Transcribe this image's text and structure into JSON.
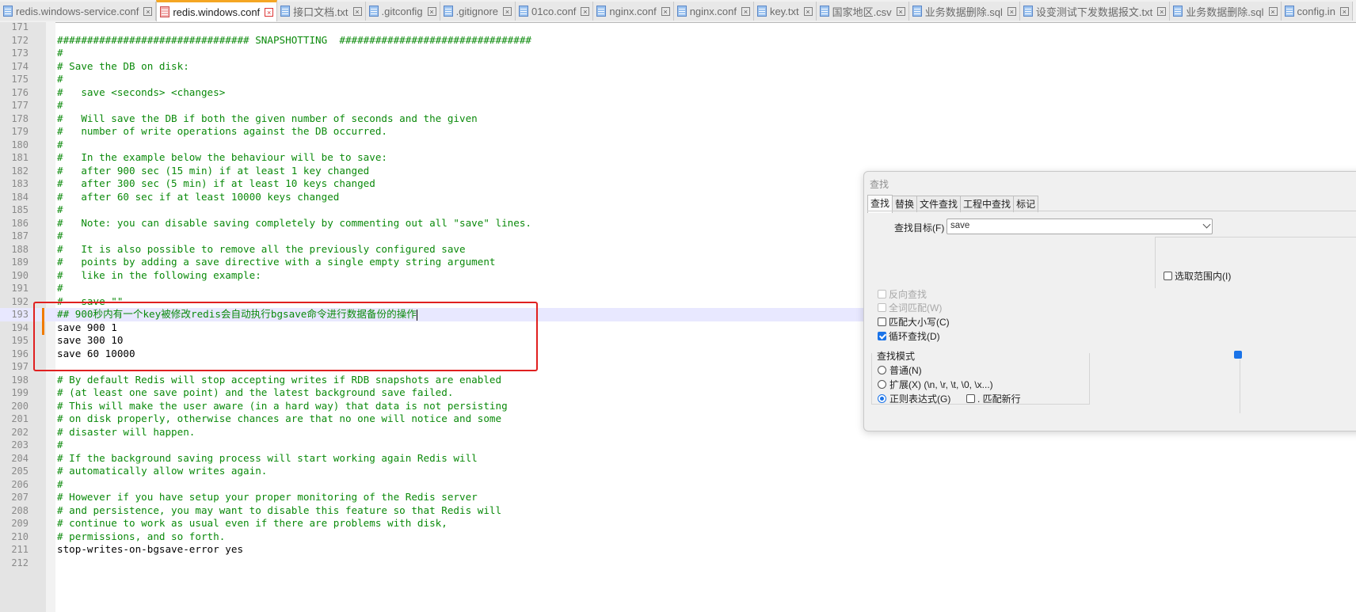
{
  "tabs": [
    {
      "label": "redis.windows-service.conf",
      "active": false
    },
    {
      "label": "redis.windows.conf",
      "active": true
    },
    {
      "label": "接口文档.txt",
      "active": false
    },
    {
      "label": ".gitconfig",
      "active": false
    },
    {
      "label": ".gitignore",
      "active": false
    },
    {
      "label": "01co.conf",
      "active": false
    },
    {
      "label": "nginx.conf",
      "active": false
    },
    {
      "label": "nginx.conf",
      "active": false
    },
    {
      "label": "key.txt",
      "active": false
    },
    {
      "label": "国家地区.csv",
      "active": false
    },
    {
      "label": "业务数据删除.sql",
      "active": false
    },
    {
      "label": "设变测试下发数据报文.txt",
      "active": false
    },
    {
      "label": "业务数据删除.sql",
      "active": false
    },
    {
      "label": "config.in",
      "active": false
    }
  ],
  "editor": {
    "current_line": "193",
    "lines": [
      {
        "n": "171",
        "text": "",
        "type": "plain"
      },
      {
        "n": "172",
        "text": "################################ SNAPSHOTTING  ################################",
        "type": "comment"
      },
      {
        "n": "173",
        "text": "#",
        "type": "comment"
      },
      {
        "n": "174",
        "text": "# Save the DB on disk:",
        "type": "comment"
      },
      {
        "n": "175",
        "text": "#",
        "type": "comment"
      },
      {
        "n": "176",
        "text": "#   save <seconds> <changes>",
        "type": "comment"
      },
      {
        "n": "177",
        "text": "#",
        "type": "comment"
      },
      {
        "n": "178",
        "text": "#   Will save the DB if both the given number of seconds and the given",
        "type": "comment"
      },
      {
        "n": "179",
        "text": "#   number of write operations against the DB occurred.",
        "type": "comment"
      },
      {
        "n": "180",
        "text": "#",
        "type": "comment"
      },
      {
        "n": "181",
        "text": "#   In the example below the behaviour will be to save:",
        "type": "comment"
      },
      {
        "n": "182",
        "text": "#   after 900 sec (15 min) if at least 1 key changed",
        "type": "comment"
      },
      {
        "n": "183",
        "text": "#   after 300 sec (5 min) if at least 10 keys changed",
        "type": "comment"
      },
      {
        "n": "184",
        "text": "#   after 60 sec if at least 10000 keys changed",
        "type": "comment"
      },
      {
        "n": "185",
        "text": "#",
        "type": "comment"
      },
      {
        "n": "186",
        "text": "#   Note: you can disable saving completely by commenting out all \"save\" lines.",
        "type": "comment"
      },
      {
        "n": "187",
        "text": "#",
        "type": "comment"
      },
      {
        "n": "188",
        "text": "#   It is also possible to remove all the previously configured save",
        "type": "comment"
      },
      {
        "n": "189",
        "text": "#   points by adding a save directive with a single empty string argument",
        "type": "comment"
      },
      {
        "n": "190",
        "text": "#   like in the following example:",
        "type": "comment"
      },
      {
        "n": "191",
        "text": "#",
        "type": "comment"
      },
      {
        "n": "192",
        "text": "#   save \"\"",
        "type": "comment"
      },
      {
        "n": "193",
        "text": "## 900秒内有一个key被修改redis会自动执行bgsave命令进行数据备份的操作",
        "type": "comment"
      },
      {
        "n": "194",
        "text": "save 900 1",
        "type": "plain"
      },
      {
        "n": "195",
        "text": "save 300 10",
        "type": "plain"
      },
      {
        "n": "196",
        "text": "save 60 10000",
        "type": "plain"
      },
      {
        "n": "197",
        "text": "",
        "type": "plain"
      },
      {
        "n": "198",
        "text": "# By default Redis will stop accepting writes if RDB snapshots are enabled",
        "type": "comment"
      },
      {
        "n": "199",
        "text": "# (at least one save point) and the latest background save failed.",
        "type": "comment"
      },
      {
        "n": "200",
        "text": "# This will make the user aware (in a hard way) that data is not persisting",
        "type": "comment"
      },
      {
        "n": "201",
        "text": "# on disk properly, otherwise chances are that no one will notice and some",
        "type": "comment"
      },
      {
        "n": "202",
        "text": "# disaster will happen.",
        "type": "comment"
      },
      {
        "n": "203",
        "text": "#",
        "type": "comment"
      },
      {
        "n": "204",
        "text": "# If the background saving process will start working again Redis will",
        "type": "comment"
      },
      {
        "n": "205",
        "text": "# automatically allow writes again.",
        "type": "comment"
      },
      {
        "n": "206",
        "text": "#",
        "type": "comment"
      },
      {
        "n": "207",
        "text": "# However if you have setup your proper monitoring of the Redis server",
        "type": "comment"
      },
      {
        "n": "208",
        "text": "# and persistence, you may want to disable this feature so that Redis will",
        "type": "comment"
      },
      {
        "n": "209",
        "text": "# continue to work as usual even if there are problems with disk,",
        "type": "comment"
      },
      {
        "n": "210",
        "text": "# permissions, and so forth.",
        "type": "comment"
      },
      {
        "n": "211",
        "text": "stop-writes-on-bgsave-error yes",
        "type": "plain"
      },
      {
        "n": "212",
        "text": "",
        "type": "plain"
      }
    ]
  },
  "find_dialog": {
    "title": "查找",
    "tabs": [
      "查找",
      "替换",
      "文件查找",
      "工程中查找",
      "标记"
    ],
    "active_tab": "查找",
    "target_label": "查找目标(F) :",
    "target_value": "save",
    "in_selection_label": "选取范围内(I)",
    "options": [
      {
        "label": "反向查找",
        "checked": false,
        "disabled": true
      },
      {
        "label": "全词匹配(W)",
        "checked": false,
        "disabled": true
      },
      {
        "label": "匹配大小写(C)",
        "checked": false,
        "disabled": false
      },
      {
        "label": "循环查找(D)",
        "checked": true,
        "disabled": false
      }
    ],
    "mode_title": "查找模式",
    "modes": [
      {
        "label": "普通(N)",
        "checked": false
      },
      {
        "label": "扩展(X) (\\n, \\r, \\t, \\0, \\x...)",
        "checked": false
      },
      {
        "label": "正则表达式(G)",
        "checked": true
      }
    ],
    "dot_newline_label": ". 匹配新行"
  },
  "colors": {
    "comment": "#0b8a0b",
    "current_line": "#e8e8ff",
    "active_tab_accent": "#f5a623",
    "annotation_box": "#e02020",
    "checkbox_checked": "#1a73e8"
  }
}
